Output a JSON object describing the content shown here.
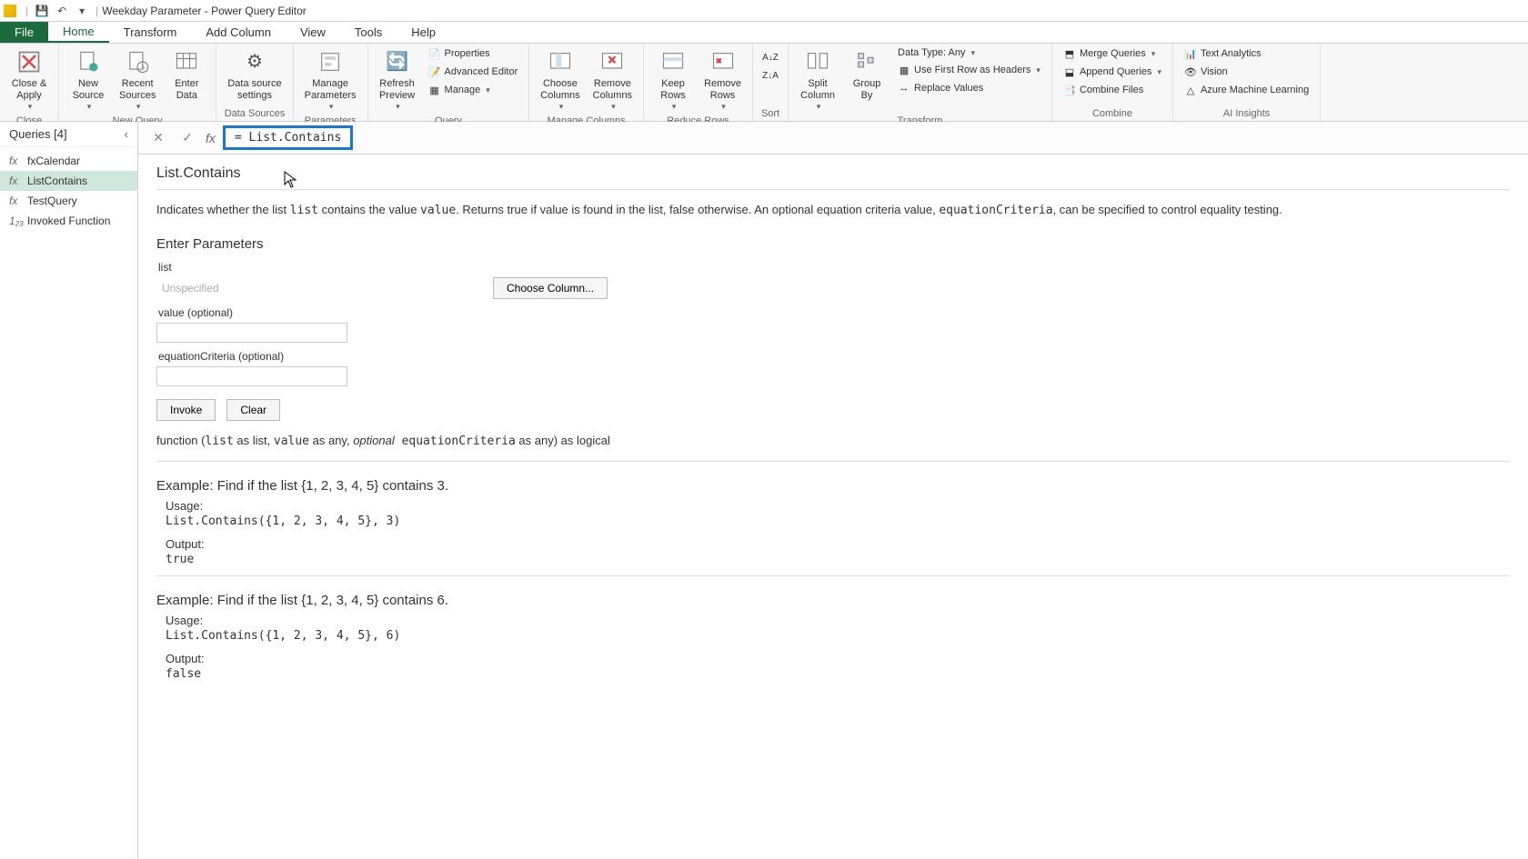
{
  "title": "Weekday Parameter - Power Query Editor",
  "ribbon_tabs": {
    "file": "File",
    "home": "Home",
    "transform": "Transform",
    "addcol": "Add Column",
    "view": "View",
    "tools": "Tools",
    "help": "Help"
  },
  "ribbon": {
    "close_apply": "Close &\nApply",
    "close_group": "Close",
    "new_source": "New\nSource",
    "recent_sources": "Recent\nSources",
    "enter_data": "Enter\nData",
    "new_query_group": "New Query",
    "data_source_settings": "Data source\nsettings",
    "data_sources_group": "Data Sources",
    "manage_parameters": "Manage\nParameters",
    "parameters_group": "Parameters",
    "refresh_preview": "Refresh\nPreview",
    "properties": "Properties",
    "advanced_editor": "Advanced Editor",
    "manage": "Manage",
    "query_group": "Query",
    "choose_columns": "Choose\nColumns",
    "remove_columns": "Remove\nColumns",
    "manage_columns_group": "Manage Columns",
    "keep_rows": "Keep\nRows",
    "remove_rows": "Remove\nRows",
    "reduce_rows_group": "Reduce Rows",
    "sort_group": "Sort",
    "split_column": "Split\nColumn",
    "group_by": "Group\nBy",
    "data_type": "Data Type: Any",
    "first_row_headers": "Use First Row as Headers",
    "replace_values": "Replace Values",
    "transform_group": "Transform",
    "merge_queries": "Merge Queries",
    "append_queries": "Append Queries",
    "combine_files": "Combine Files",
    "combine_group": "Combine",
    "text_analytics": "Text Analytics",
    "vision": "Vision",
    "azure_ml": "Azure Machine Learning",
    "ai_group": "AI Insights"
  },
  "queries": {
    "header": "Queries [4]",
    "items": [
      {
        "icon": "fx",
        "label": "fxCalendar"
      },
      {
        "icon": "fx",
        "label": "ListContains"
      },
      {
        "icon": "fx",
        "label": "TestQuery"
      },
      {
        "icon": "1₂₃",
        "label": "Invoked Function"
      }
    ]
  },
  "formula": "= List.Contains",
  "func": {
    "name": "List.Contains",
    "desc_pre": "Indicates whether the list ",
    "desc_code1": "list",
    "desc_mid1": " contains the value ",
    "desc_code2": "value",
    "desc_mid2": ". Returns true if value is found in the list, false otherwise. An optional equation criteria value, ",
    "desc_code3": "equationCriteria",
    "desc_post": ", can be specified to control equality testing.",
    "enter_params": "Enter Parameters",
    "p_list": "list",
    "p_list_ph": "Unspecified",
    "choose_column": "Choose Column...",
    "p_value": "value (optional)",
    "p_eq": "equationCriteria (optional)",
    "invoke": "Invoke",
    "clear": "Clear",
    "sig_pre": "function (",
    "sig_c1": "list",
    "sig_t1": " as list, ",
    "sig_c2": "value",
    "sig_t2": " as any, ",
    "sig_opt": "optional",
    "sig_c3": " equationCriteria",
    "sig_t3": " as any) as logical",
    "ex1_title": "Example: Find if the list {1, 2, 3, 4, 5} contains 3.",
    "usage": "Usage:",
    "ex1_code": "List.Contains({1, 2, 3, 4, 5}, 3)",
    "output": "Output:",
    "ex1_out": "true",
    "ex2_title": "Example: Find if the list {1, 2, 3, 4, 5} contains 6.",
    "ex2_code": "List.Contains({1, 2, 3, 4, 5}, 6)",
    "ex2_out": "false"
  }
}
